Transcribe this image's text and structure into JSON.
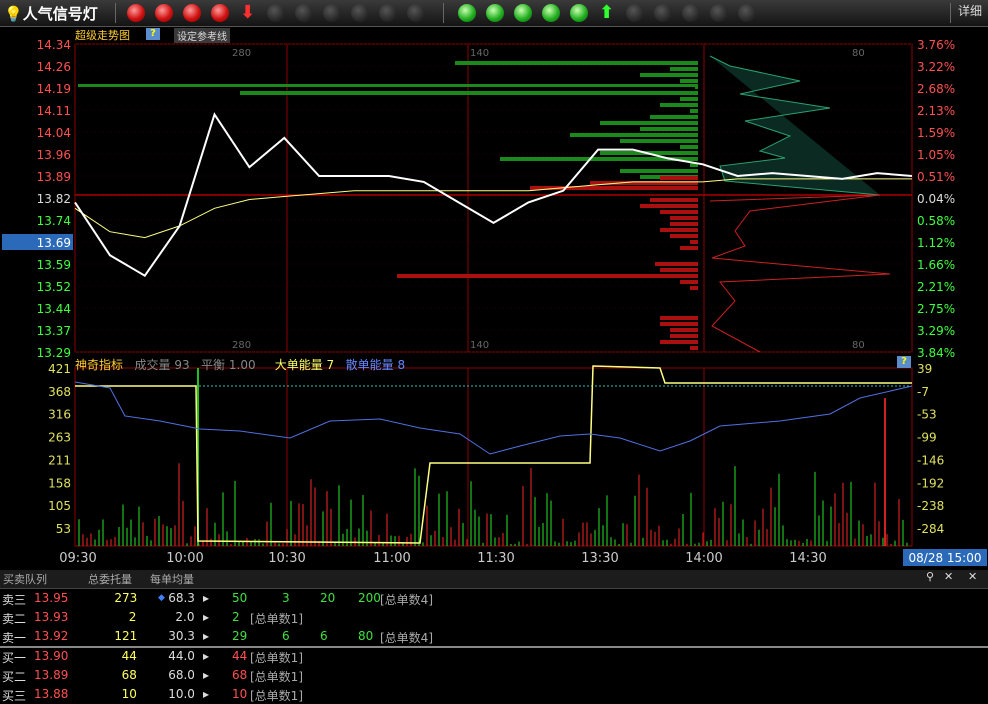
{
  "toolbar": {
    "title": "人气信号灯",
    "detail_label": "详细",
    "lights": [
      {
        "icon": "red-light-icon",
        "state": "red"
      },
      {
        "icon": "red-light-icon",
        "state": "red"
      },
      {
        "icon": "red-light-icon",
        "state": "red"
      },
      {
        "icon": "red-light-icon",
        "state": "red"
      },
      {
        "icon": "red-down-arrow-icon",
        "state": "arrow-down"
      },
      {
        "icon": "off-light-icon",
        "state": "off"
      },
      {
        "icon": "off-light-icon",
        "state": "off"
      },
      {
        "icon": "off-light-icon",
        "state": "off"
      },
      {
        "icon": "off-light-icon",
        "state": "off"
      },
      {
        "icon": "off-light-icon",
        "state": "off"
      },
      {
        "icon": "off-light-icon",
        "state": "off"
      },
      {
        "icon": "green-light-icon",
        "state": "green"
      },
      {
        "icon": "green-light-icon",
        "state": "green"
      },
      {
        "icon": "green-light-icon",
        "state": "green"
      },
      {
        "icon": "green-light-icon",
        "state": "green"
      },
      {
        "icon": "green-light-icon",
        "state": "green"
      },
      {
        "icon": "green-up-arrow-icon",
        "state": "arrow-up"
      },
      {
        "icon": "off-light-icon",
        "state": "off"
      },
      {
        "icon": "off-light-icon",
        "state": "off"
      },
      {
        "icon": "off-light-icon",
        "state": "off"
      },
      {
        "icon": "off-light-icon",
        "state": "off"
      },
      {
        "icon": "off-light-icon",
        "state": "off"
      }
    ]
  },
  "price_panel": {
    "title": "超级走势图",
    "help_icon": "help-icon",
    "ref_button": "设定参考线",
    "y_labels": [
      "14.34",
      "14.26",
      "14.19",
      "14.11",
      "14.04",
      "13.96",
      "13.89",
      "13.82",
      "13.74",
      "13.69",
      "13.59",
      "13.52",
      "13.44",
      "13.37",
      "13.29"
    ],
    "current_price": "13.69",
    "pct_labels": [
      "3.76%",
      "3.22%",
      "2.68%",
      "2.13%",
      "1.59%",
      "1.05%",
      "0.51%",
      "0.04%",
      "0.58%",
      "1.12%",
      "1.66%",
      "2.21%",
      "2.75%",
      "3.29%",
      "3.84%"
    ],
    "vol_scale_labels": [
      "280",
      "140",
      "80"
    ],
    "colors": {
      "up": "#ff4040",
      "down": "#40ff40",
      "price_line": "#ffffff",
      "avg_line": "#ffff80"
    }
  },
  "chart_data": [
    {
      "type": "line",
      "title": "",
      "xlabel": "",
      "ylabel": "",
      "x": [
        "09:30",
        "09:40",
        "09:50",
        "10:00",
        "10:10",
        "10:20",
        "10:30",
        "10:40",
        "10:50",
        "11:00",
        "11:10",
        "11:20",
        "11:30",
        "13:10",
        "13:20",
        "13:30",
        "13:40",
        "13:50",
        "14:00",
        "14:10",
        "14:20",
        "14:30",
        "14:40",
        "14:50",
        "15:00"
      ],
      "series": [
        {
          "name": "",
          "values": [
            13.8,
            13.62,
            13.55,
            13.72,
            14.1,
            13.92,
            14.02,
            13.89,
            13.89,
            13.89,
            13.87,
            13.8,
            13.73,
            13.8,
            13.84,
            13.98,
            13.98,
            13.95,
            13.93,
            13.89,
            13.9,
            13.89,
            13.88,
            13.9,
            13.89
          ]
        },
        {
          "name": "",
          "values": [
            13.78,
            13.7,
            13.68,
            13.72,
            13.78,
            13.81,
            13.82,
            13.83,
            13.84,
            13.84,
            13.84,
            13.84,
            13.84,
            13.84,
            13.85,
            13.86,
            13.87,
            13.87,
            13.87,
            13.88,
            13.88,
            13.88,
            13.88,
            13.88,
            13.88
          ]
        }
      ],
      "ylim": [
        13.29,
        14.34
      ]
    },
    {
      "type": "bar",
      "title": "神奇指标",
      "legend": [
        {
          "name": "成交量",
          "value": "93"
        },
        {
          "name": "平衡",
          "value": "1.00"
        },
        {
          "name": "大单能量",
          "value": "7"
        },
        {
          "name": "散单能量",
          "value": "8"
        }
      ],
      "x": [
        "09:30",
        "10:00",
        "10:30",
        "11:00",
        "11:30",
        "13:30",
        "14:00",
        "14:30",
        "15:00"
      ],
      "y_left": [
        "421",
        "368",
        "316",
        "263",
        "211",
        "158",
        "105",
        "53"
      ],
      "y_right": [
        "39",
        "-7",
        "-53",
        "-99",
        "-146",
        "-192",
        "-238",
        "-284"
      ],
      "series": [
        {
          "name": "大单能量",
          "values": [
            380,
            372,
            20,
            10,
            10,
            10,
            220,
            415,
            385,
            380,
            380
          ]
        },
        {
          "name": "散单能量",
          "values": [
            380,
            340,
            300,
            270,
            265,
            245,
            285,
            290,
            320,
            360,
            380
          ]
        }
      ]
    }
  ],
  "time_axis": {
    "labels": [
      "09:30",
      "10:00",
      "10:30",
      "11:00",
      "11:30",
      "13:30",
      "14:00",
      "14:30"
    ],
    "cursor": "08/28 15:00"
  },
  "queue": {
    "title": "买卖队列",
    "col_total": "总委托量",
    "col_avg": "每单均量",
    "rows": [
      {
        "label": "卖三",
        "price": "13.95",
        "total": "273",
        "avg": "68.3",
        "orders": [
          "50",
          "3",
          "20",
          "200"
        ],
        "note": "[总单数4]",
        "side": "sell"
      },
      {
        "label": "卖二",
        "price": "13.93",
        "total": "2",
        "avg": "2.0",
        "orders": [
          "2"
        ],
        "note": "[总单数1]",
        "side": "sell"
      },
      {
        "label": "卖一",
        "price": "13.92",
        "total": "121",
        "avg": "30.3",
        "orders": [
          "29",
          "6",
          "6",
          "80"
        ],
        "note": "[总单数4]",
        "side": "sell"
      },
      {
        "label": "买一",
        "price": "13.90",
        "total": "44",
        "avg": "44.0",
        "orders": [
          "44"
        ],
        "note": "[总单数1]",
        "side": "buy"
      },
      {
        "label": "买二",
        "price": "13.89",
        "total": "68",
        "avg": "68.0",
        "orders": [
          "68"
        ],
        "note": "[总单数1]",
        "side": "buy"
      },
      {
        "label": "买三",
        "price": "13.88",
        "total": "10",
        "avg": "10.0",
        "orders": [
          "10"
        ],
        "note": "[总单数1]",
        "side": "buy"
      }
    ]
  }
}
